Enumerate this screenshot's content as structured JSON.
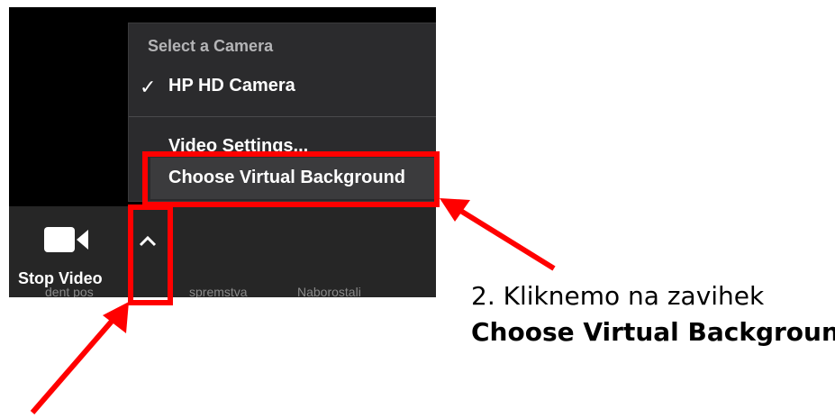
{
  "camera_menu": {
    "header": "Select a Camera",
    "selected_camera": "HP HD Camera",
    "check_mark": "✓",
    "video_settings": "Video Settings...",
    "virtual_background": "Choose Virtual Background"
  },
  "toolbar": {
    "stop_video_label": "Stop Video",
    "video_icon": "video-camera-icon",
    "caret_icon": "chevron-up-icon",
    "cut_text_1": "dent pos",
    "cut_text_2": "spremstva",
    "cut_text_3": "Naborostali"
  },
  "annotation": {
    "step_text": "2. Kliknemo na zavihek",
    "step_target": "Choose Virtual Background",
    "highlight_color": "#ff0000"
  }
}
